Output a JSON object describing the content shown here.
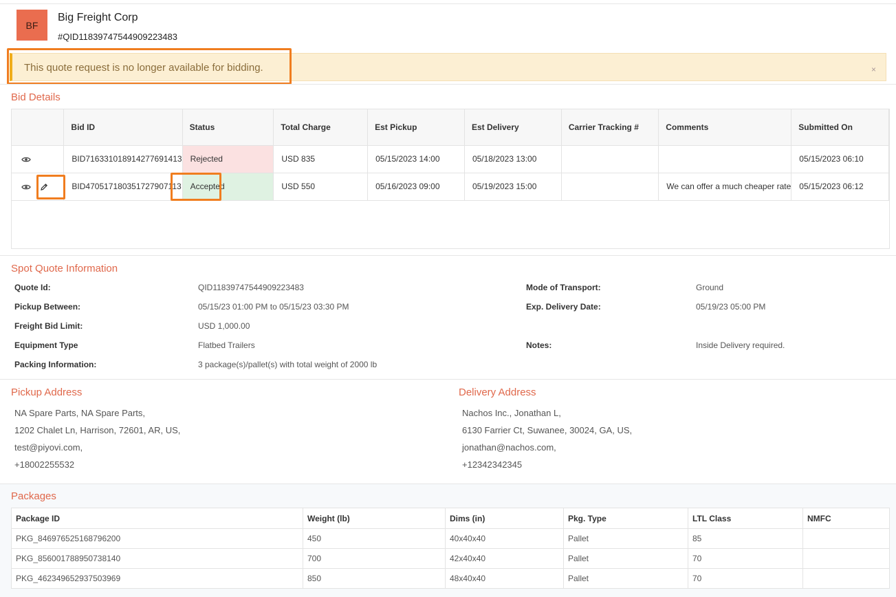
{
  "header": {
    "avatar_initials": "BF",
    "company_name": "Big Freight Corp",
    "quote_number": "#QID11839747544909223483"
  },
  "alert": {
    "message": "This quote request is no longer available for bidding.",
    "close_label": "×"
  },
  "bid_details": {
    "title": "Bid Details",
    "columns": [
      "",
      "Bid ID",
      "Status",
      "Total Charge",
      "Est Pickup",
      "Est Delivery",
      "Carrier Tracking #",
      "Comments",
      "Submitted On"
    ],
    "rows": [
      {
        "bid_id": "BID716331018914277691413",
        "status": "Rejected",
        "total_charge": "USD 835",
        "est_pickup": "05/15/2023 14:00",
        "est_delivery": "05/18/2023 13:00",
        "tracking": "",
        "comments": "",
        "submitted_on": "05/15/2023 06:10"
      },
      {
        "bid_id": "BID470517180351727907113",
        "status": "Accepted",
        "total_charge": "USD 550",
        "est_pickup": "05/16/2023 09:00",
        "est_delivery": "05/19/2023 15:00",
        "tracking": "",
        "comments": "We can offer a much cheaper rate",
        "submitted_on": "05/15/2023 06:12"
      }
    ]
  },
  "spot_quote": {
    "title": "Spot Quote Information",
    "quote_id_label": "Quote Id:",
    "quote_id": "QID11839747544909223483",
    "pickup_between_label": "Pickup Between:",
    "pickup_between": "05/15/23 01:00 PM to 05/15/23 03:30 PM",
    "freight_bid_limit_label": "Freight Bid Limit:",
    "freight_bid_limit": "USD 1,000.00",
    "equipment_type_label": "Equipment Type",
    "equipment_type": "Flatbed Trailers",
    "packing_info_label": "Packing Information:",
    "packing_info": "3 package(s)/pallet(s) with total weight of 2000 lb",
    "mode_label": "Mode of Transport:",
    "mode": "Ground",
    "exp_delivery_label": "Exp. Delivery Date:",
    "exp_delivery": "05/19/23 05:00 PM",
    "notes_label": "Notes:",
    "notes": "Inside Delivery required."
  },
  "pickup_address": {
    "title": "Pickup Address",
    "line1": "NA Spare Parts, NA Spare Parts,",
    "line2": "1202 Chalet Ln, Harrison, 72601, AR, US,",
    "email": "test@piyovi.com,",
    "phone": "+18002255532"
  },
  "delivery_address": {
    "title": "Delivery Address",
    "line1": "Nachos Inc., Jonathan L,",
    "line2": "6130 Farrier Ct, Suwanee, 30024, GA, US,",
    "email": "jonathan@nachos.com,",
    "phone": "+12342342345"
  },
  "packages": {
    "title": "Packages",
    "columns": [
      "Package ID",
      "Weight (lb)",
      "Dims (in)",
      "Pkg. Type",
      "LTL Class",
      "NMFC"
    ],
    "rows": [
      {
        "id": "PKG_846976525168796200",
        "weight": "450",
        "dims": "40x40x40",
        "type": "Pallet",
        "ltl": "85",
        "nmfc": ""
      },
      {
        "id": "PKG_856001788950738140",
        "weight": "700",
        "dims": "42x40x40",
        "type": "Pallet",
        "ltl": "70",
        "nmfc": ""
      },
      {
        "id": "PKG_462349652937503969",
        "weight": "850",
        "dims": "48x40x40",
        "type": "Pallet",
        "ltl": "70",
        "nmfc": ""
      }
    ]
  },
  "colors": {
    "accent": "#e0684b",
    "avatar_bg": "#ea6d4f",
    "alert_bg": "#fcefd3",
    "alert_border": "#f0ad1a",
    "rejected_bg": "#fbe1e1",
    "accepted_bg": "#dff2e2",
    "highlight": "#f07d1f"
  },
  "icons": {
    "view": "eye-icon",
    "edit": "pencil-icon",
    "close": "close-icon"
  }
}
